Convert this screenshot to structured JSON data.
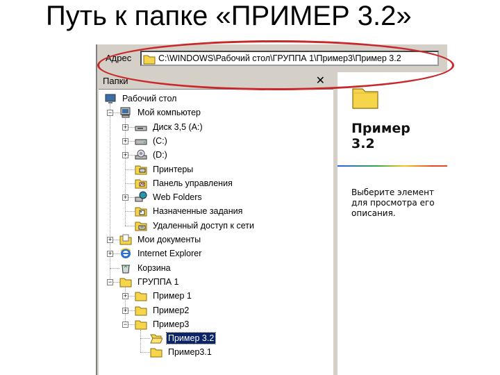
{
  "slide": {
    "title": "Путь  к папке «ПРИМЕР 3.2»"
  },
  "address_bar": {
    "label": "Адрес",
    "path": "C:\\WINDOWS\\Рабочий стол\\ГРУППА 1\\Пример3\\Пример 3.2"
  },
  "folders_pane": {
    "title": "Папки",
    "close_glyph": "✕",
    "items": [
      {
        "label": "Рабочий стол",
        "icon": "desktop-icon",
        "level": 0,
        "expander": "none"
      },
      {
        "label": "Мой компьютер",
        "icon": "computer-icon",
        "level": 1,
        "expander": "minus"
      },
      {
        "label": "Диск 3,5 (A:)",
        "icon": "floppy-drive-icon",
        "level": 2,
        "expander": "plus"
      },
      {
        "label": "(C:)",
        "icon": "hard-drive-icon",
        "level": 2,
        "expander": "plus"
      },
      {
        "label": "(D:)",
        "icon": "cd-drive-icon",
        "level": 2,
        "expander": "plus"
      },
      {
        "label": "Принтеры",
        "icon": "printers-folder-icon",
        "level": 2,
        "expander": "none"
      },
      {
        "label": "Панель управления",
        "icon": "control-panel-icon",
        "level": 2,
        "expander": "none"
      },
      {
        "label": "Web Folders",
        "icon": "web-folders-icon",
        "level": 2,
        "expander": "plus"
      },
      {
        "label": "Назначенные задания",
        "icon": "scheduled-tasks-icon",
        "level": 2,
        "expander": "none"
      },
      {
        "label": "Удаленный доступ к сети",
        "icon": "dial-up-icon",
        "level": 2,
        "expander": "none"
      },
      {
        "label": "Мои документы",
        "icon": "my-documents-icon",
        "level": 1,
        "expander": "plus"
      },
      {
        "label": "Internet Explorer",
        "icon": "internet-explorer-icon",
        "level": 1,
        "expander": "plus"
      },
      {
        "label": "Корзина",
        "icon": "recycle-bin-icon",
        "level": 1,
        "expander": "none"
      },
      {
        "label": "ГРУППА 1",
        "icon": "folder-icon",
        "level": 1,
        "expander": "minus"
      },
      {
        "label": "Пример 1",
        "icon": "folder-icon",
        "level": 2,
        "expander": "plus"
      },
      {
        "label": "Пример2",
        "icon": "folder-icon",
        "level": 2,
        "expander": "plus"
      },
      {
        "label": "Пример3",
        "icon": "folder-icon",
        "level": 2,
        "expander": "minus"
      },
      {
        "label": "Пример 3.2",
        "icon": "folder-open-icon",
        "level": 3,
        "expander": "none",
        "selected": true
      },
      {
        "label": "Пример3.1",
        "icon": "folder-icon",
        "level": 3,
        "expander": "none"
      }
    ]
  },
  "preview": {
    "title_line1": "Пример",
    "title_line2": "3.2",
    "desc_line1": "Выберите элемент",
    "desc_line2": "для просмотра его",
    "desc_line3": "описания."
  },
  "colors": {
    "highlight_oval": "#c8282a",
    "selection": "#0a246a",
    "chrome": "#d4d0c8"
  }
}
